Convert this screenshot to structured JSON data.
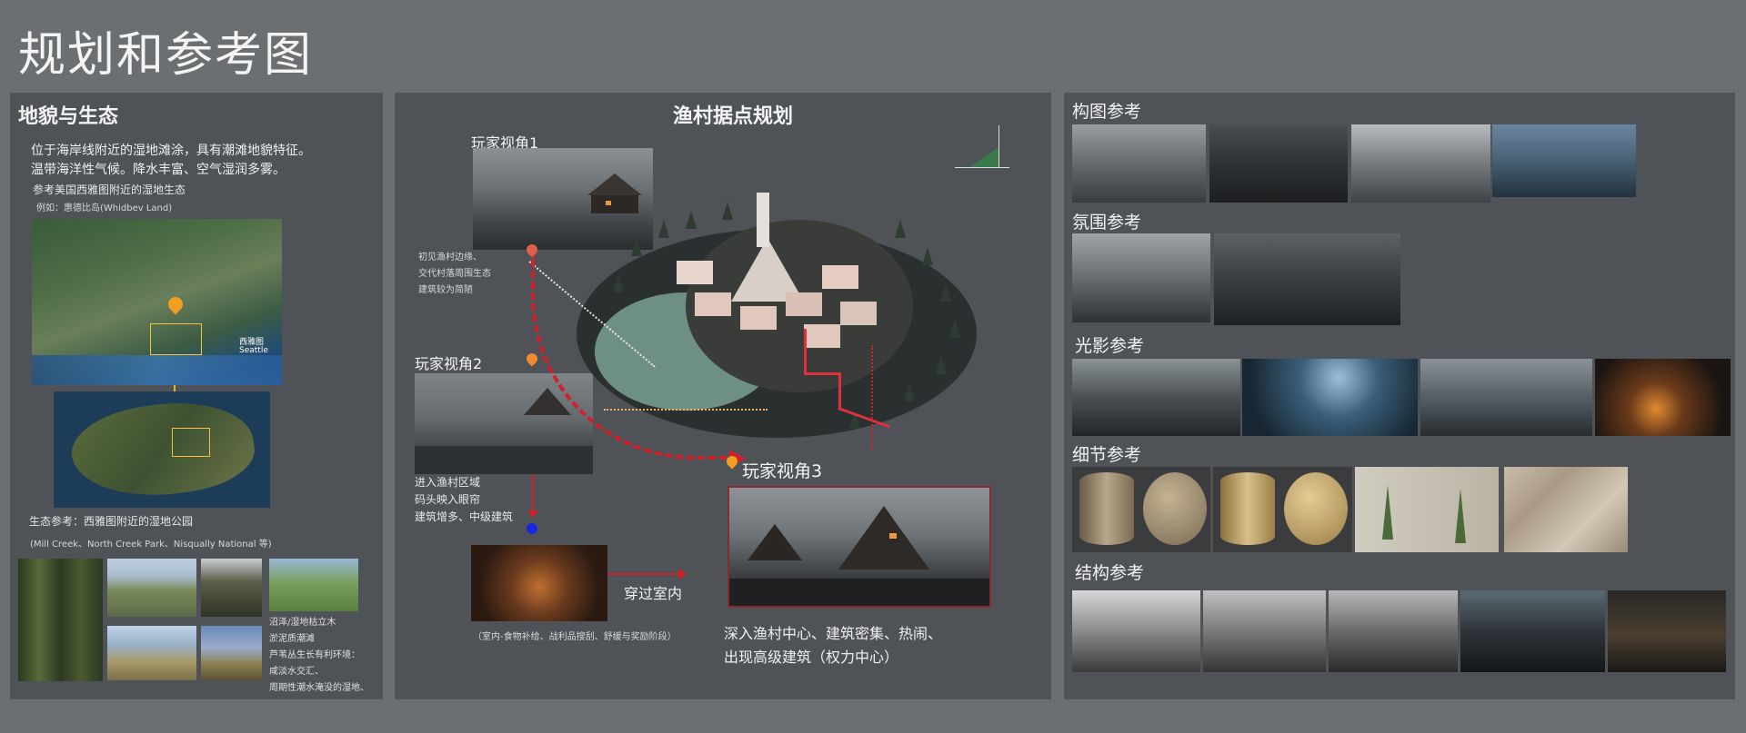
{
  "page": {
    "title": "规划和参考图"
  },
  "terrain": {
    "heading": "地貌与生态",
    "desc_line1": "位于海岸线附近的湿地滩涂，具有潮滩地貌特征。",
    "desc_line2": "温带海洋性气候。降水丰富、空气湿润多雾。",
    "ref_line": "参考美国西雅图附近的湿地生态",
    "example": "例如：惠德比岛(Whidbev Land)",
    "map_label_seattle_cn": "西雅图",
    "map_label_seattle": "Seattle",
    "eco_title": "生态参考：西雅图附近的湿地公园",
    "eco_parks": "(Mill Creek、North Creek Park、Nisqually National 等)",
    "eco_note_lines": [
      "沼泽/湿地枯立木",
      "淤泥质潮滩",
      "芦苇丛生长有利环境：",
      "咸淡水交汇、",
      "周期性潮水淹没的湿地、"
    ]
  },
  "village": {
    "heading": "渔村据点规划",
    "view1_label": "玩家视角1",
    "view1_notes": [
      "初见渔村边缘、",
      "交代村落周围生态",
      "建筑较为简陋"
    ],
    "view2_label": "玩家视角2",
    "view2_notes": [
      "进入渔村区域",
      "码头映入眼帘",
      "建筑增多、中级建筑"
    ],
    "view3_label": "玩家视角3",
    "view3_notes": [
      "深入渔村中心、建筑密集、热闹、",
      "出现高级建筑（权力中心）"
    ],
    "interior_label": "穿过室内",
    "interior_note": "（室内-食物补给、战利品搜刮、舒缓与奖励阶段）"
  },
  "references": {
    "composition": "构图参考",
    "atmosphere": "氛围参考",
    "lighting": "光影参考",
    "detail": "细节参考",
    "structure": "结构参考"
  },
  "colors": {
    "background": "#6b6f72",
    "panel": "#4f5257",
    "route_red": "#d0202a",
    "accent_orange": "#f08a30",
    "path_white": "#e8ead8",
    "frame_red": "#8a2a2e"
  }
}
